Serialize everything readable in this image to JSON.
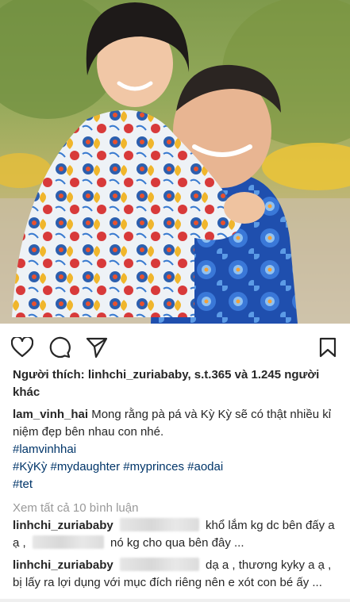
{
  "likes": {
    "prefix": "Người thích:",
    "users": "linhchi_zuriababy, s.t.365",
    "and_word": "và",
    "others_count": "1.245",
    "others_word": "người khác"
  },
  "caption": {
    "username": "lam_vinh_hai",
    "text": "Mong rằng pà pá và Kỳ Kỳ sẽ có thật nhiều kỉ niệm đẹp bên nhau con nhé.",
    "hashtags_line1": "#lamvinhhai",
    "hashtags_line2": [
      "#KỳKỳ",
      "#mydaughter",
      "#myprinces",
      "#aodai"
    ],
    "hashtags_line3": "#tet"
  },
  "view_all_comments": "Xem tất cả 10 bình luận",
  "comments": [
    {
      "username": "linhchi_zuriababy",
      "text_part1": "khổ lắm kg dc bên đấy a ạ ,",
      "text_part2": "nó kg cho qua bên đây ..."
    },
    {
      "username": "linhchi_zuriababy",
      "text_part1": "dạ a , thương kyky a ạ , bị lấy ra lợi dụng với mục đích riêng nên e xót con bé ấy ..."
    }
  ],
  "icons": {
    "like": "heart-icon",
    "comment": "comment-icon",
    "share": "share-icon",
    "save": "bookmark-icon"
  },
  "colors": {
    "text": "#262626",
    "hashtag": "#003569",
    "muted": "#999999"
  }
}
